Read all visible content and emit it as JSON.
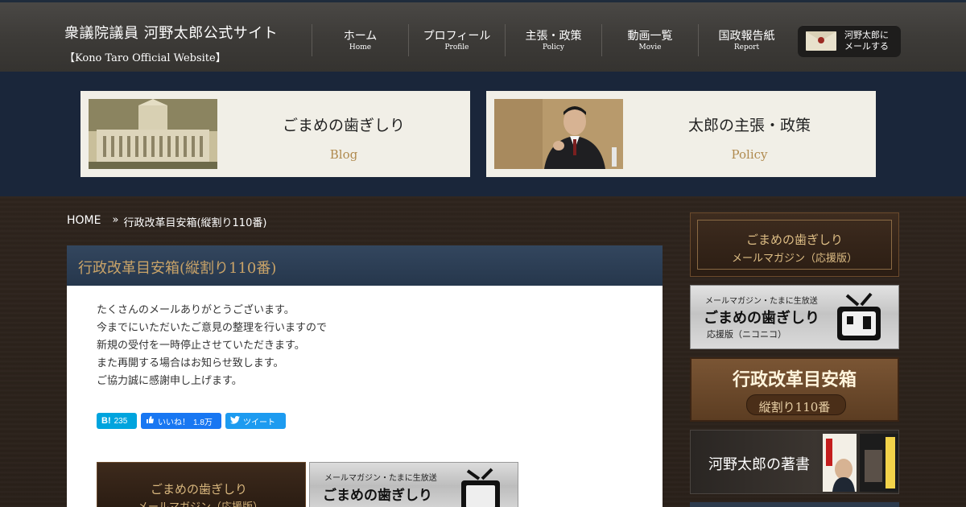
{
  "header": {
    "site_title": "衆議院議員 河野太郎公式サイト",
    "site_subtitle": "【Kono Taro Official Website】",
    "nav": [
      {
        "jp": "ホーム",
        "en": "Home"
      },
      {
        "jp": "プロフィール",
        "en": "Profile"
      },
      {
        "jp": "主張・政策",
        "en": "Policy"
      },
      {
        "jp": "動画一覧",
        "en": "Movie"
      },
      {
        "jp": "国政報告紙",
        "en": "Report"
      }
    ],
    "mail_button": {
      "line1": "河野太郎に",
      "line2": "メールする"
    }
  },
  "banners": [
    {
      "title": "ごまめの歯ぎしり",
      "sub": "Blog"
    },
    {
      "title": "太郎の主張・政策",
      "sub": "Policy"
    }
  ],
  "breadcrumb": {
    "home": "HOME",
    "separator": "»",
    "current": "行政改革目安箱(縦割り110番)"
  },
  "article": {
    "title": "行政改革目安箱(縦割り110番)",
    "lines": [
      "たくさんのメールありがとうございます。",
      "今までにいただいたご意見の整理を行いますので",
      "新規の受付を一時停止させていただきます。",
      "また再開する場合はお知らせ致します。",
      "ご協力誠に感謝申し上げます。"
    ],
    "share": {
      "hatena_label": "B!",
      "hatena_count": "235",
      "fb_label": "いいね！",
      "fb_count": "1.8万",
      "tw_label": "ツイート"
    },
    "bottom_banners": {
      "b1_line1": "ごまめの歯ぎしり",
      "b1_line2": "メールマガジン（応援版）",
      "b2_line1": "メールマガジン・たまに生放送",
      "b2_line2": "ごまめの歯ぎしり"
    }
  },
  "sidebar": {
    "b1_line1": "ごまめの歯ぎしり",
    "b1_line2": "メールマガジン（応援版）",
    "b2_line1": "メールマガジン・たまに生放送",
    "b2_line2": "ごまめの歯ぎしり",
    "b2_line3": "応援版（ニコニコ）",
    "b3_line1": "行政改革目安箱",
    "b3_line2": "縦割り110番",
    "b4_line1": "河野太郎の著書"
  }
}
